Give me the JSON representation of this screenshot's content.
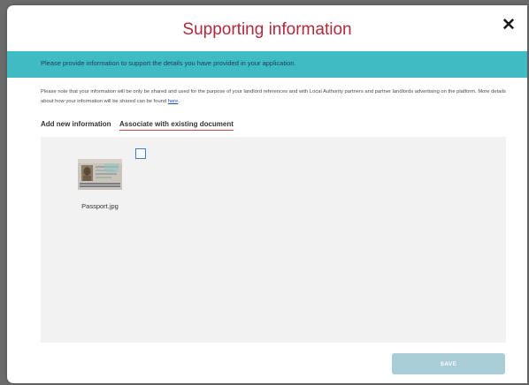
{
  "modal": {
    "title": "Supporting information",
    "close_icon": "close-icon",
    "close_glyph": "✕"
  },
  "banner": {
    "text": "Please provide information to support the details you have provided in your application.",
    "color": "#3fbcc3"
  },
  "notice": {
    "text_before_link": "Please note that your information will be only be shared and used for the purpose of your landlord references and with Local Authority partners and partner landlords advertising on the platform. More details about how your information will be shared can be found ",
    "link_text": "here",
    "text_after_link": "."
  },
  "tabs": [
    {
      "label": "Add new information",
      "active": false
    },
    {
      "label": "Associate with existing document",
      "active": true
    }
  ],
  "documents": [
    {
      "name": "Passport.jpg",
      "icon": "passport-thumbnail",
      "checked": false
    }
  ],
  "footer": {
    "save_label": "SAVE",
    "save_color": "#a9cdd7"
  },
  "colors": {
    "title": "#b12a3c",
    "tab_underline": "#d44a4a",
    "checkbox_border": "#3f7fc8",
    "panel_bg": "#f2f2f2"
  }
}
